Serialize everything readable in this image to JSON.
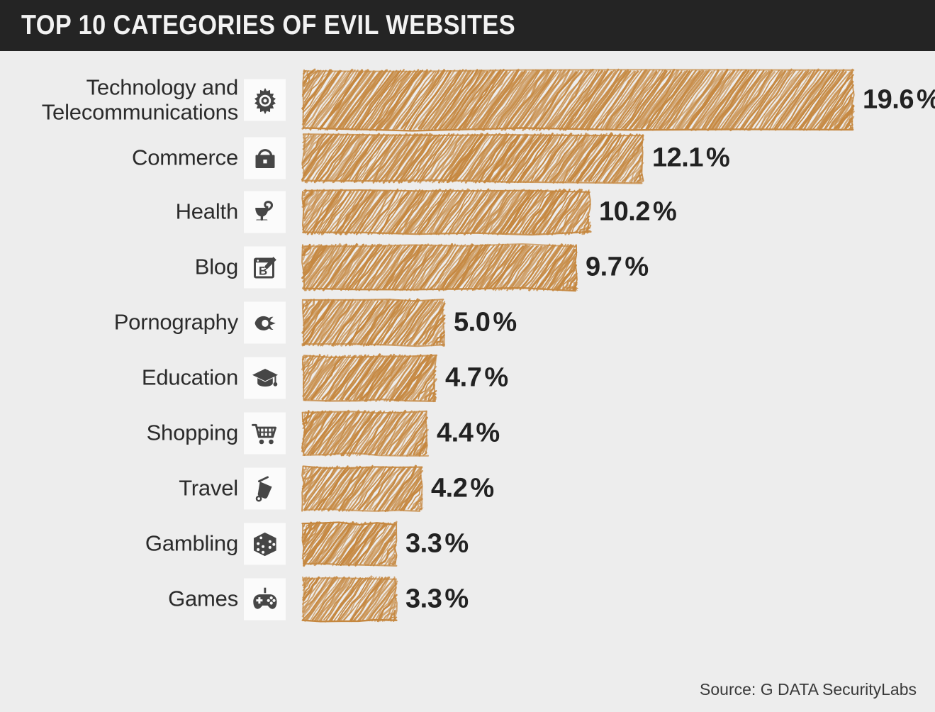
{
  "header": {
    "title": "TOP 10 CATEGORIES OF EVIL WEBSITES"
  },
  "footer": {
    "source": "Source: G DATA SecurityLabs"
  },
  "colors": {
    "background": "#ededed",
    "title_bar": "#242424",
    "title_text": "#f2f2f2",
    "bar": "#c5873f",
    "label_text": "#2b2b2b",
    "value_text": "#222222",
    "icon_tile": "#fbfbfb",
    "icon_glyph": "#464646"
  },
  "chart_data": {
    "type": "bar",
    "orientation": "horizontal",
    "title": "TOP 10 CATEGORIES OF EVIL WEBSITES",
    "xlabel": "",
    "ylabel": "",
    "unit": "%",
    "xlim": [
      0,
      19.6
    ],
    "grid": false,
    "legend": false,
    "source": "Source: G DATA SecurityLabs",
    "categories": [
      "Technology and\nTelecommunications",
      "Commerce",
      "Health",
      "Blog",
      "Pornography",
      "Education",
      "Shopping",
      "Travel",
      "Gambling",
      "Games"
    ],
    "values": [
      19.6,
      12.1,
      10.2,
      9.7,
      5.0,
      4.7,
      4.4,
      4.2,
      3.3,
      3.3
    ],
    "value_labels": [
      "19.6",
      "12.1",
      "10.2",
      "9.7",
      "5.0",
      "4.7",
      "4.4",
      "4.2",
      "3.3",
      "3.3"
    ],
    "icons": [
      "gear-icon",
      "padlock-icon",
      "bowl-of-hygieia-icon",
      "blog-pencil-icon",
      "lips-icon",
      "graduation-cap-icon",
      "shopping-cart-icon",
      "suitcase-icon",
      "dice-icon",
      "gamepad-icon"
    ]
  }
}
